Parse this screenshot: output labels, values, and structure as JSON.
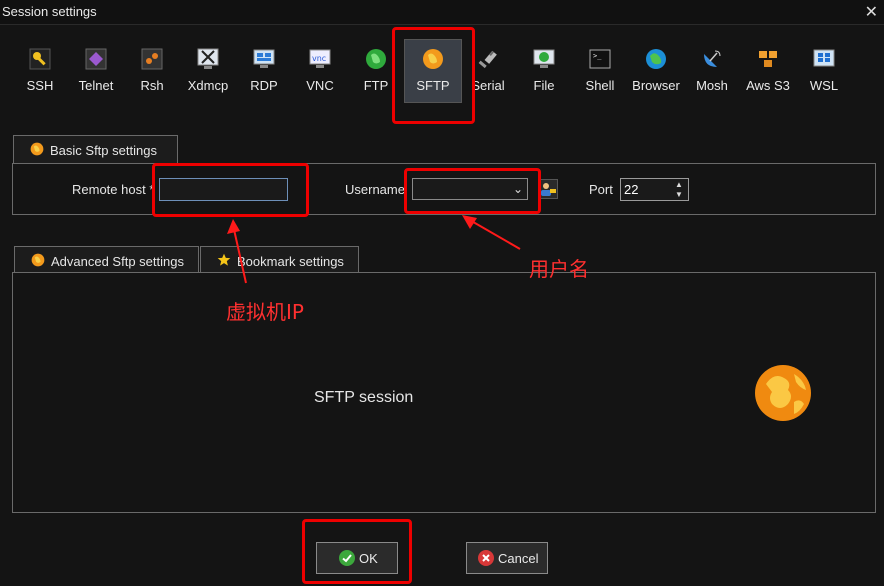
{
  "window": {
    "title": "Session settings",
    "close_glyph": "✕"
  },
  "session_types": [
    {
      "label": "SSH",
      "icon": "ssh-key-icon"
    },
    {
      "label": "Telnet",
      "icon": "telnet-icon"
    },
    {
      "label": "Rsh",
      "icon": "rsh-icon"
    },
    {
      "label": "Xdmcp",
      "icon": "xdmcp-icon"
    },
    {
      "label": "RDP",
      "icon": "rdp-icon"
    },
    {
      "label": "VNC",
      "icon": "vnc-icon"
    },
    {
      "label": "FTP",
      "icon": "ftp-globe-icon"
    },
    {
      "label": "SFTP",
      "icon": "sftp-globe-icon",
      "selected": true
    },
    {
      "label": "Serial",
      "icon": "serial-plug-icon"
    },
    {
      "label": "File",
      "icon": "file-icon"
    },
    {
      "label": "Shell",
      "icon": "shell-icon"
    },
    {
      "label": "Browser",
      "icon": "browser-globe-icon"
    },
    {
      "label": "Mosh",
      "icon": "mosh-satellite-icon"
    },
    {
      "label": "Aws S3",
      "icon": "aws-s3-icon"
    },
    {
      "label": "WSL",
      "icon": "wsl-windows-icon"
    }
  ],
  "basic_tab": {
    "label": "Basic Sftp settings"
  },
  "basic": {
    "remote_host_label": "Remote host *",
    "remote_host_value": "",
    "username_label": "Username",
    "username_value": "",
    "port_label": "Port",
    "port_value": "22"
  },
  "lower_tabs": [
    {
      "label": "Advanced Sftp settings",
      "icon": "sftp-globe-icon"
    },
    {
      "label": "Bookmark settings",
      "icon": "star-icon"
    }
  ],
  "main": {
    "session_label": "SFTP session"
  },
  "buttons": {
    "ok": "OK",
    "cancel": "Cancel"
  },
  "annotations": {
    "host": "虚拟机IP",
    "username": "用户名"
  },
  "colors": {
    "annotation_red": "#ff1a1a",
    "sftp_orange": "#f39a1c",
    "ok_green": "#3ca83c",
    "cancel_red": "#d83838"
  }
}
